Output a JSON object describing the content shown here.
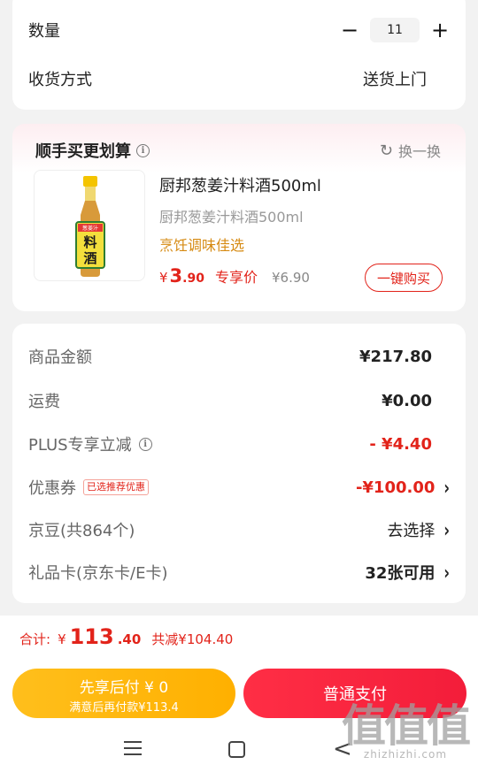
{
  "order": {
    "quantity_label": "数量",
    "quantity_value": "11",
    "minus_label": "−",
    "plus_label": "+",
    "shipping_label": "收货方式",
    "shipping_value": "送货上门"
  },
  "bundle": {
    "title": "顺手买更划算",
    "info_icon": "i",
    "swap_icon": "↻",
    "swap_label": "换一换",
    "product": {
      "name": "厨邦葱姜汁料酒500ml",
      "subtitle": "厨邦葱姜汁料酒500ml",
      "tag": "烹饪调味佳选",
      "price_symbol": "¥",
      "price_int": "3",
      "price_dec": ".90",
      "exclusive_label": "专享价",
      "original_price": "¥6.90",
      "bottle_label_top": "葱姜汁",
      "bottle_label_a": "料",
      "bottle_label_b": "酒",
      "buy_button": "一键购买"
    }
  },
  "summary": {
    "rows": [
      {
        "label": "商品金额",
        "value": "¥217.80"
      },
      {
        "label": "运费",
        "value": "¥0.00"
      },
      {
        "label": "PLUS专享立减",
        "value": "- ¥4.40"
      },
      {
        "label": "优惠券",
        "badge": "已选推荐优惠",
        "value": "-¥100.00"
      },
      {
        "label": "京豆(共864个)",
        "value": "去选择"
      },
      {
        "label": "礼品卡(京东卡/E卡)",
        "value": "32张可用"
      }
    ],
    "chevron": "›"
  },
  "footer": {
    "total_label": "合计:",
    "total_symbol": "¥",
    "total_int": "113",
    "total_dec": ".40",
    "savings": "共减¥104.40",
    "pay_later_title": "先享后付 ¥ 0",
    "pay_later_sub": "满意后再付款¥113.4",
    "pay_normal": "普通支付"
  },
  "watermark": {
    "big": "值值值",
    "small": "zhizhizhi.com"
  },
  "nav": {
    "back_icon": "<"
  },
  "colors": {
    "accent_red": "#e2231a",
    "pay_later_orange": "#ffb000",
    "tag_orange": "#d68a12"
  }
}
